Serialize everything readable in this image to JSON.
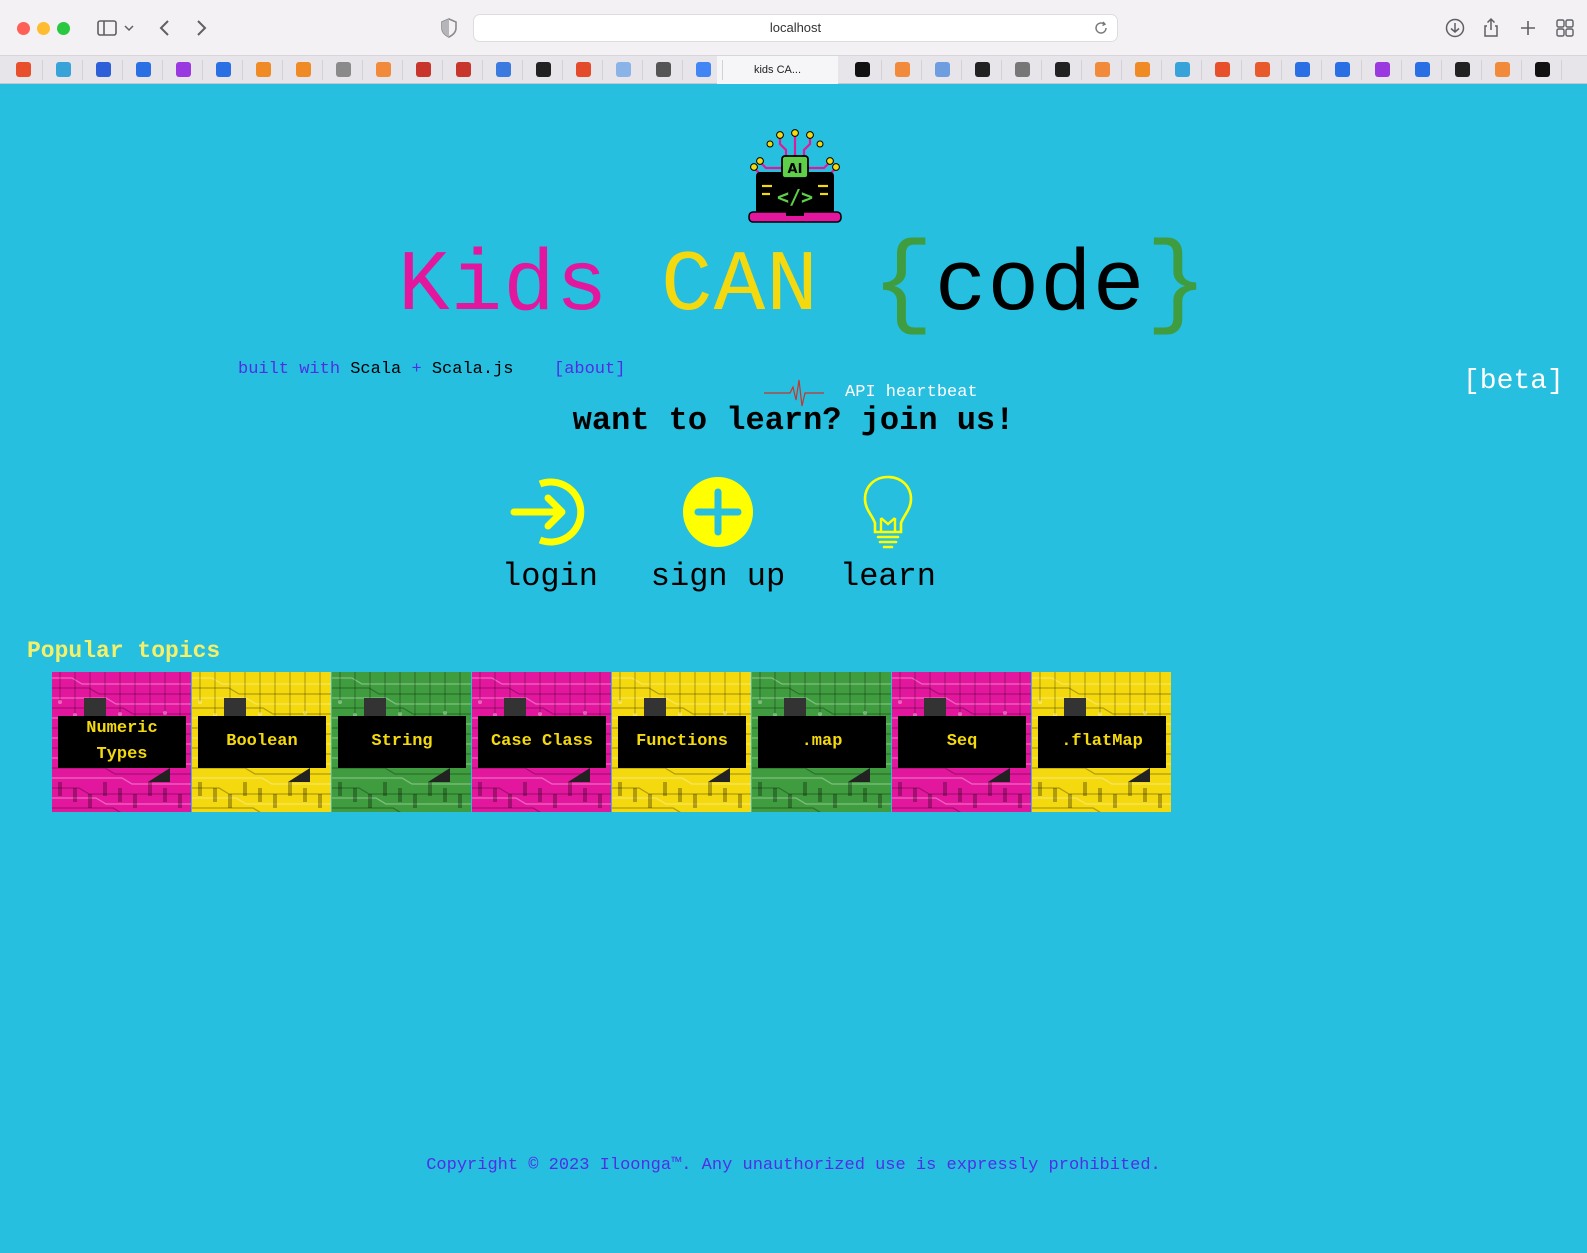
{
  "browser": {
    "url": "localhost",
    "active_tab_title": "kids CA...",
    "favicon_colors": [
      "#e8502b",
      "#38a3d8",
      "#2d5fd8",
      "#2a6fe4",
      "#9b39e0",
      "#2a6fe4",
      "#f08a24",
      "#f08a24",
      "#8a8a8a",
      "#f28a3b",
      "#c8352b",
      "#c8352b",
      "#3b7be0",
      "#222222",
      "#e44b2a",
      "#8ab4e8",
      "#555555",
      "#4285f4",
      "#111111",
      "#f28a3b",
      "#6e9ee0",
      "#222222",
      "#777777",
      "#222222",
      "#f28a3b",
      "#f08a24",
      "#38a3d8",
      "#e8502b",
      "#e85a2b",
      "#2a6fe4",
      "#2a6fe4",
      "#9b39e0",
      "#2a6fe4",
      "#222222",
      "#f28a3b",
      "#111111"
    ]
  },
  "page": {
    "hero": {
      "kids": "Kids",
      "can": "CAN",
      "open_brace": "{",
      "code": "code",
      "close_brace": "}"
    },
    "built_with": {
      "prefix": "built with",
      "scala": "Scala",
      "plus": "+",
      "scalajs": "Scala.js"
    },
    "about_link": "[about]",
    "heartbeat_label": "API heartbeat",
    "beta": "[beta]",
    "tagline": "want to learn? join us!",
    "actions": [
      {
        "label": "login",
        "icon": "login-icon"
      },
      {
        "label": "sign up",
        "icon": "plus-circle-icon"
      },
      {
        "label": "learn",
        "icon": "lightbulb-icon"
      }
    ],
    "popular_title": "Popular topics",
    "topics": [
      {
        "label": "Numeric Types",
        "color": "#e3179e"
      },
      {
        "label": "Boolean",
        "color": "#f4d90e"
      },
      {
        "label": "String",
        "color": "#3f9d3f"
      },
      {
        "label": "Case Class",
        "color": "#e3179e"
      },
      {
        "label": "Functions",
        "color": "#f4d90e"
      },
      {
        "label": ".map",
        "color": "#3f9d3f"
      },
      {
        "label": "Seq",
        "color": "#e3179e"
      },
      {
        "label": ".flatMap",
        "color": "#f4d90e"
      }
    ],
    "copyright": "Copyright © 2023 Iloonga™. Any unauthorized use is expressly prohibited."
  },
  "colors": {
    "background": "#26bfdf",
    "magenta": "#e3179e",
    "yellow": "#f4d90e",
    "green": "#3f9d3f",
    "link_blue": "#4f2ee6",
    "icon_yellow": "#ffff00"
  }
}
